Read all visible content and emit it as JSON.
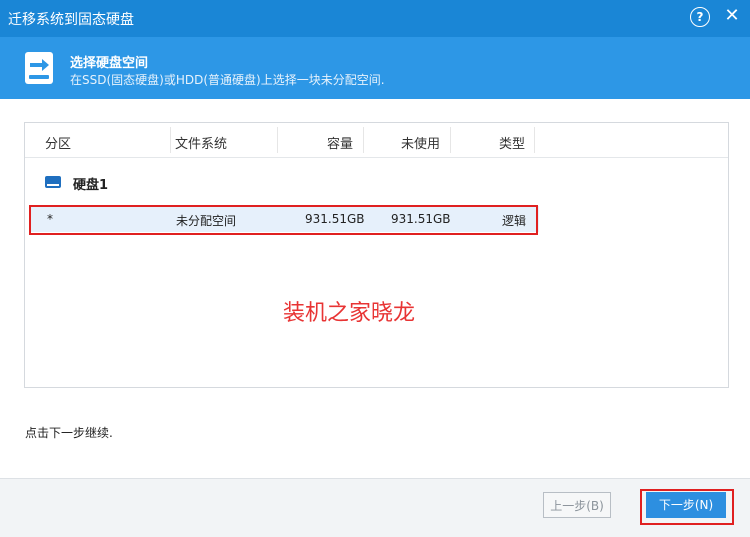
{
  "window": {
    "title": "迁移系统到固态硬盘",
    "help_label": "?",
    "close_label": "✕"
  },
  "header": {
    "title": "选择硬盘空间",
    "subtitle": "在SSD(固态硬盘)或HDD(普通硬盘)上选择一块未分配空间."
  },
  "table": {
    "columns": [
      "分区",
      "文件系统",
      "容量",
      "未使用",
      "类型"
    ],
    "disk_label": "硬盘1",
    "rows": [
      {
        "partition": "*",
        "filesystem": "未分配空间",
        "capacity": "931.51GB",
        "unused": "931.51GB",
        "type": "逻辑"
      }
    ]
  },
  "watermark": "装机之家晓龙",
  "hint": "点击下一步继续.",
  "footer": {
    "prev_label": "上一步(B)",
    "next_label": "下一步(N)"
  },
  "colors": {
    "titlebar": "#1a86d6",
    "header": "#2d97e6",
    "selected_row": "#e6f0fb",
    "highlight": "#e02020"
  }
}
